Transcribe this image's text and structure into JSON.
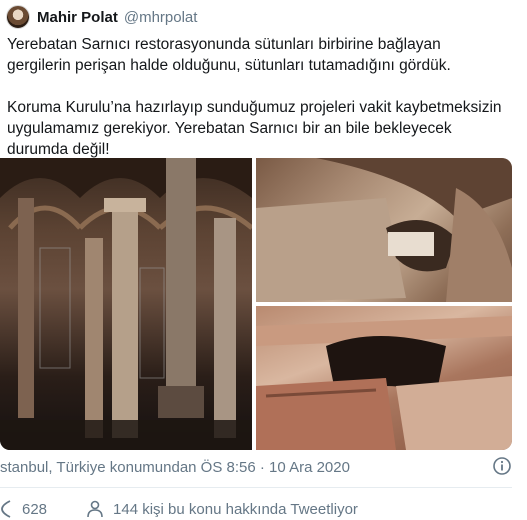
{
  "author": {
    "name": "Mahir Polat",
    "handle": "@mhrpolat"
  },
  "tweet": {
    "paragraph1": "Yerebatan Sarnıcı restorasyonunda sütunları birbirine bağlayan gergilerin perişan halde olduğunu, sütunları tutamadığını gördük.",
    "paragraph2": "Koruma Kurulu’na hazırlayıp sunduğumuz projeleri vakit kaybetmeksizin uygulamamız gerekiyor.  Yerebatan Sarnıcı bir an bile bekleyecek durumda değil!"
  },
  "media": {
    "icons": [
      "cistern-columns-photo",
      "damaged-stone-photo",
      "damaged-arch-photo"
    ]
  },
  "meta": {
    "location_time": "stanbul, Türkiye konumundan ÖS 8:56 · 10 Ara 2020"
  },
  "actions": {
    "likes": "628",
    "talking": "144 kişi bu konu hakkında Tweetliyor"
  },
  "colors": {
    "text": "#14171a",
    "secondary": "#657786",
    "divider": "#e6ecf0"
  }
}
